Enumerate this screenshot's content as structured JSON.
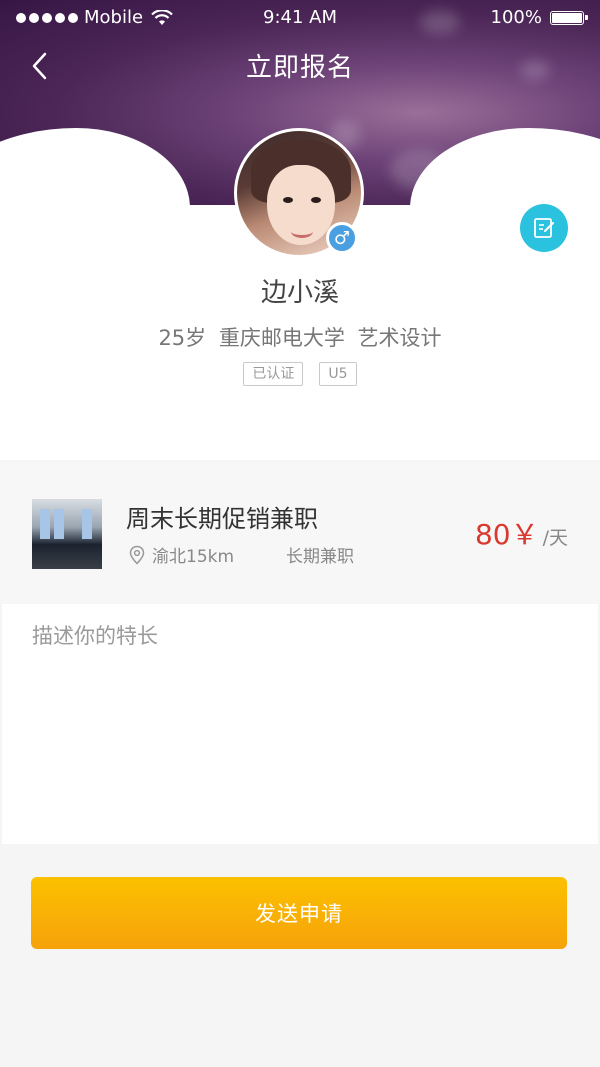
{
  "status_bar": {
    "carrier": "Mobile",
    "time": "9:41 AM",
    "battery": "100%",
    "battery_level": 1.0
  },
  "header": {
    "title": "立即报名",
    "back_icon": "chevron-left-icon"
  },
  "profile": {
    "name": "边小溪",
    "age": "25岁",
    "school": "重庆邮电大学",
    "major": "艺术设计",
    "tags": [
      "已认证",
      "U5"
    ],
    "gender_symbol": "♂",
    "gender_color": "#4a9fe0",
    "edit_icon": "edit-icon",
    "edit_color": "#2bc2e0"
  },
  "job": {
    "title": "周末长期促销兼职",
    "location": "渝北15km",
    "type": "长期兼职",
    "price": "80￥",
    "unit": "/天",
    "price_color": "#d9392f"
  },
  "description": {
    "placeholder": "描述你的特长"
  },
  "submit": {
    "label": "发送申请",
    "color": "#fcc100"
  }
}
